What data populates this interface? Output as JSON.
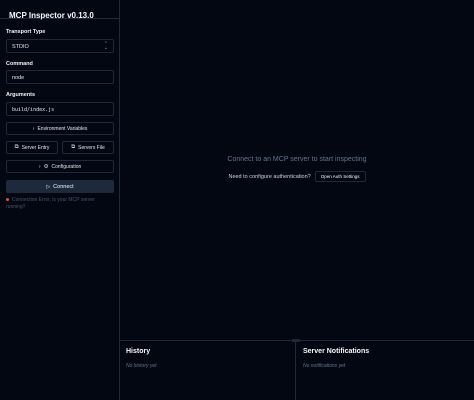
{
  "app": {
    "title": "MCP Inspector v0.13.0"
  },
  "sidebar": {
    "transport_label": "Transport Type",
    "transport_value": "STDIO",
    "command_label": "Command",
    "command_value": "node",
    "arguments_label": "Arguments",
    "arguments_value": "build/index.js",
    "env_button": "Environment Variables",
    "server_entry_button": "Server Entry",
    "servers_file_button": "Servers File",
    "config_button": "Configuration",
    "connect_button": "Connect",
    "error_text": "Connection Error, is your MCP server running?"
  },
  "main": {
    "hint": "Connect to an MCP server to start inspecting",
    "auth_question": "Need to configure authentication?",
    "auth_button": "Open Auth Settings"
  },
  "history": {
    "title": "History",
    "empty": "No history yet"
  },
  "notifications": {
    "title": "Server Notifications",
    "empty": "No notifications yet"
  },
  "colors": {
    "background": "#030712",
    "border": "#1e293b",
    "error": "#ef4444"
  }
}
